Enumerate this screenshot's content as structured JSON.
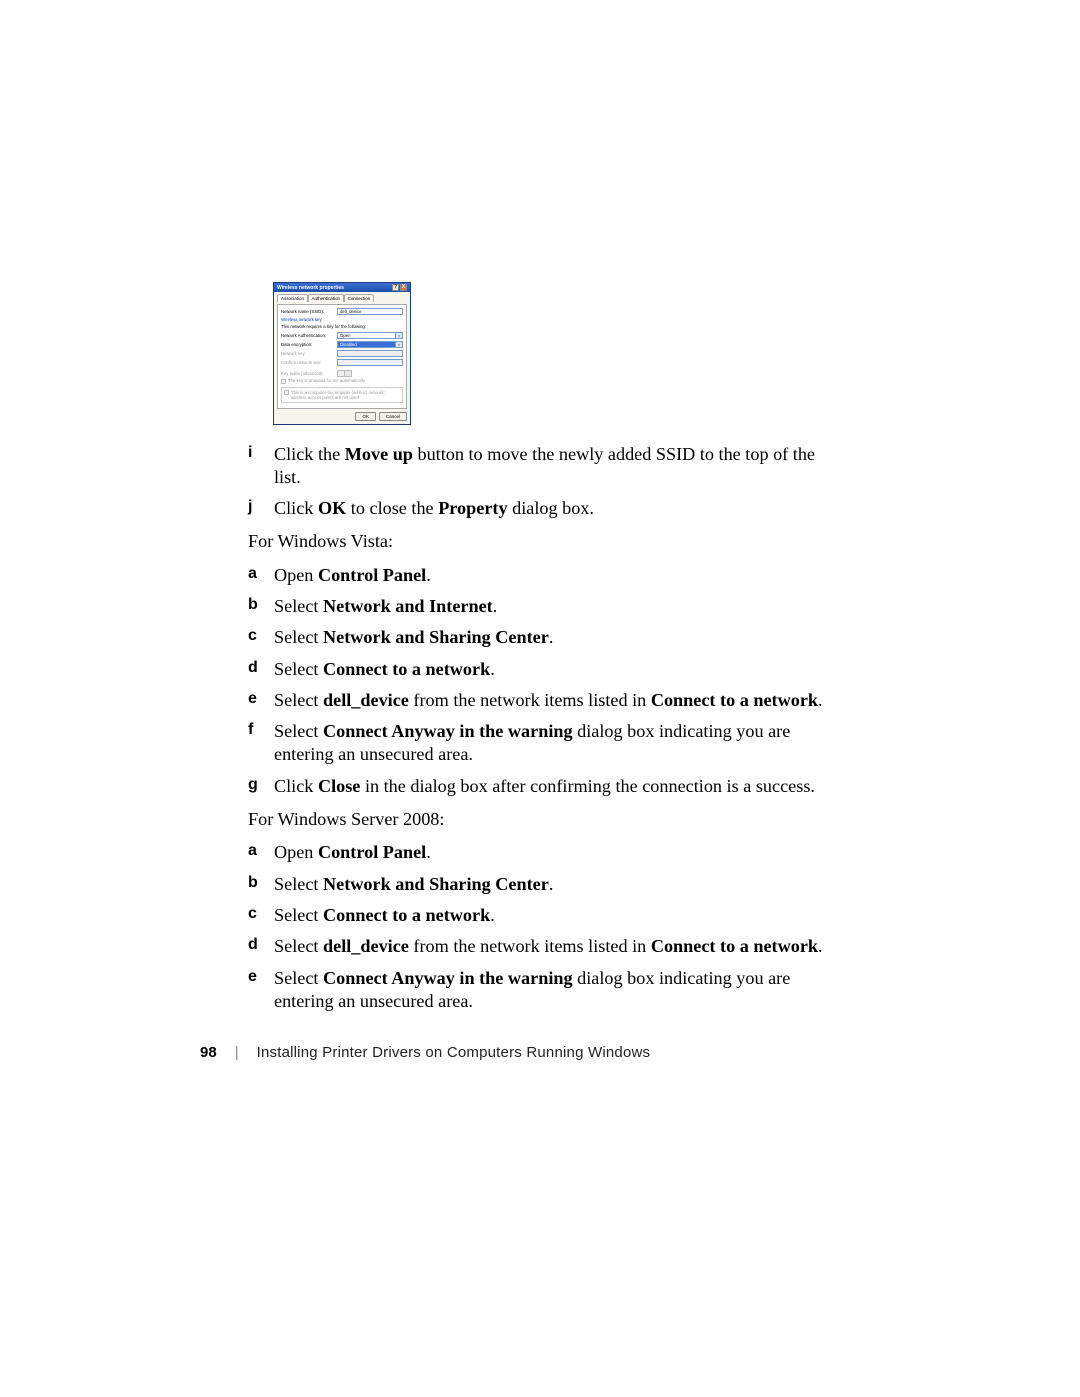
{
  "dialog": {
    "title": "Wireless network properties",
    "help_btn": "?",
    "close_btn": "X",
    "tabs": {
      "association": "Association",
      "authentication": "Authentication",
      "connection": "Connection"
    },
    "network_name_label": "Network name (SSID):",
    "network_name_value": "dell_device",
    "wireless_key_link": "Wireless network key",
    "requires_key_text": "This network requires a key for the following:",
    "network_auth_label": "Network Authentication:",
    "network_auth_value": "Open",
    "data_encryption_label": "Data encryption:",
    "data_encryption_value": "Disabled",
    "network_key_label": "Network key:",
    "confirm_key_label": "Confirm network key:",
    "key_index_label": "Key index (advanced):",
    "key_index_value": "1",
    "key_auto_text": "The key is provided for me automatically",
    "adhoc_text": "This is a computer-to-computer (ad hoc) network; wireless access points are not used",
    "ok": "OK",
    "cancel": "Cancel"
  },
  "steps": {
    "i": {
      "prefix": "Click the ",
      "bold": "Move up",
      "suffix": " button to move the newly added SSID to the top of the list."
    },
    "j": {
      "prefix": "Click ",
      "bold1": "OK",
      "mid": " to close the ",
      "bold2": "Property",
      "suffix": " dialog box."
    }
  },
  "vista": {
    "heading": "For Windows Vista:",
    "a": {
      "prefix": "Open ",
      "bold": "Control Panel",
      "suffix": "."
    },
    "b": {
      "prefix": "Select ",
      "bold": "Network and Internet",
      "suffix": "."
    },
    "c": {
      "prefix": "Select ",
      "bold": "Network and Sharing Center",
      "suffix": "."
    },
    "d": {
      "prefix": "Select ",
      "bold": "Connect to a network",
      "suffix": "."
    },
    "e": {
      "prefix": "Select ",
      "bold1": "dell_device",
      "mid": " from the network items listed in ",
      "bold2": "Connect to a network",
      "suffix": "."
    },
    "f": {
      "prefix": "Select ",
      "bold": "Connect Anyway in the warning",
      "suffix": " dialog box indicating you are entering an unsecured area."
    },
    "g": {
      "prefix": "Click ",
      "bold": "Close",
      "suffix": " in the dialog box after confirming the connection is a success."
    }
  },
  "server2008": {
    "heading": "For Windows Server 2008:",
    "a": {
      "prefix": "Open ",
      "bold": "Control Panel",
      "suffix": "."
    },
    "b": {
      "prefix": "Select ",
      "bold": "Network and Sharing Center",
      "suffix": "."
    },
    "c": {
      "prefix": "Select ",
      "bold": "Connect to a network",
      "suffix": "."
    },
    "d": {
      "prefix": "Select ",
      "bold1": "dell_device",
      "mid": " from the network items listed in ",
      "bold2": "Connect to a network",
      "suffix": "."
    },
    "e": {
      "prefix": "Select ",
      "bold": "Connect Anyway in the warning",
      "suffix": " dialog box indicating you are entering an unsecured area."
    }
  },
  "footer": {
    "page": "98",
    "sep": "|",
    "text": "Installing Printer Drivers on Computers Running Windows"
  },
  "markers": {
    "i": "i",
    "j": "j",
    "a": "a",
    "b": "b",
    "c": "c",
    "d": "d",
    "e": "e",
    "f": "f",
    "g": "g"
  }
}
